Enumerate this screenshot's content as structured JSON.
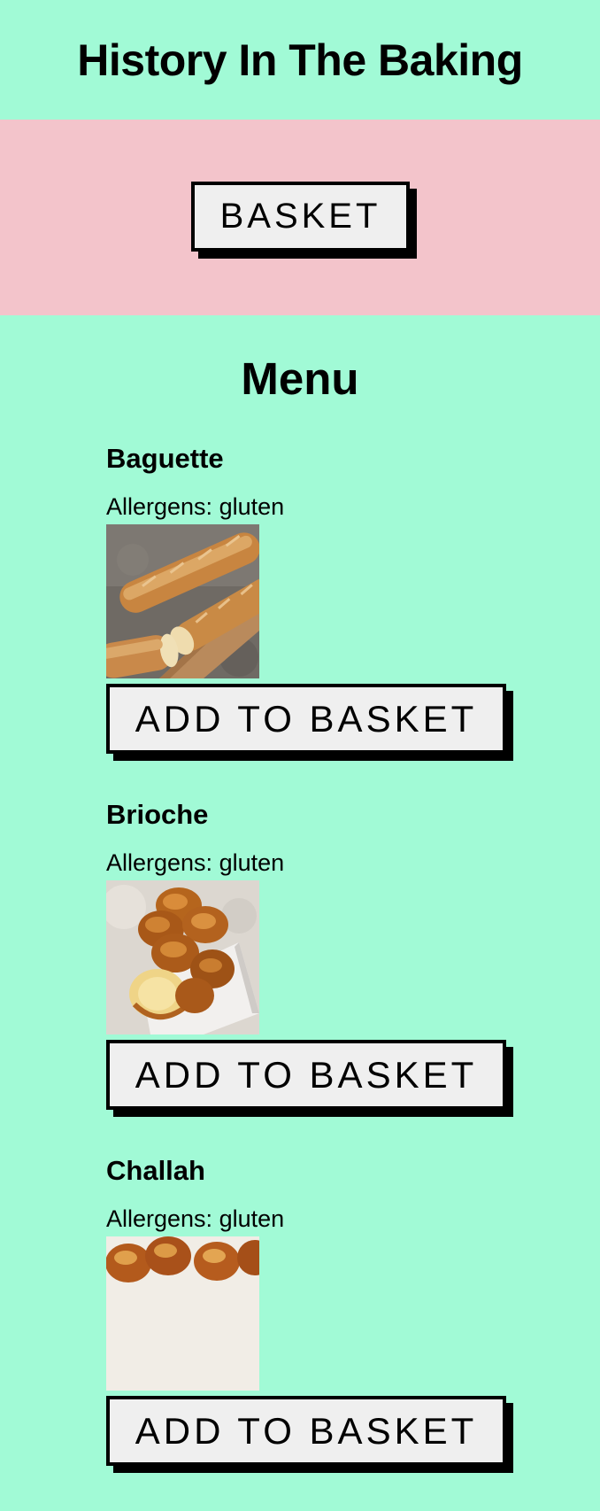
{
  "header": {
    "title": "History In The Baking"
  },
  "basket_bar": {
    "basket_label": "BASKET"
  },
  "menu": {
    "title": "Menu",
    "items": [
      {
        "name": "Baguette",
        "allergens": "Allergens: gluten",
        "photo": "baguette-photo",
        "add_label": "ADD TO BASKET"
      },
      {
        "name": "Brioche",
        "allergens": "Allergens: gluten",
        "photo": "brioche-photo",
        "add_label": "ADD TO BASKET"
      },
      {
        "name": "Challah",
        "allergens": "Allergens: gluten",
        "photo": "challah-photo",
        "add_label": "ADD TO BASKET"
      }
    ]
  },
  "colors": {
    "page_background": "#a1fad6",
    "basket_bar_background": "#f3c4cb",
    "button_background": "#efefef",
    "button_border": "#000000"
  }
}
